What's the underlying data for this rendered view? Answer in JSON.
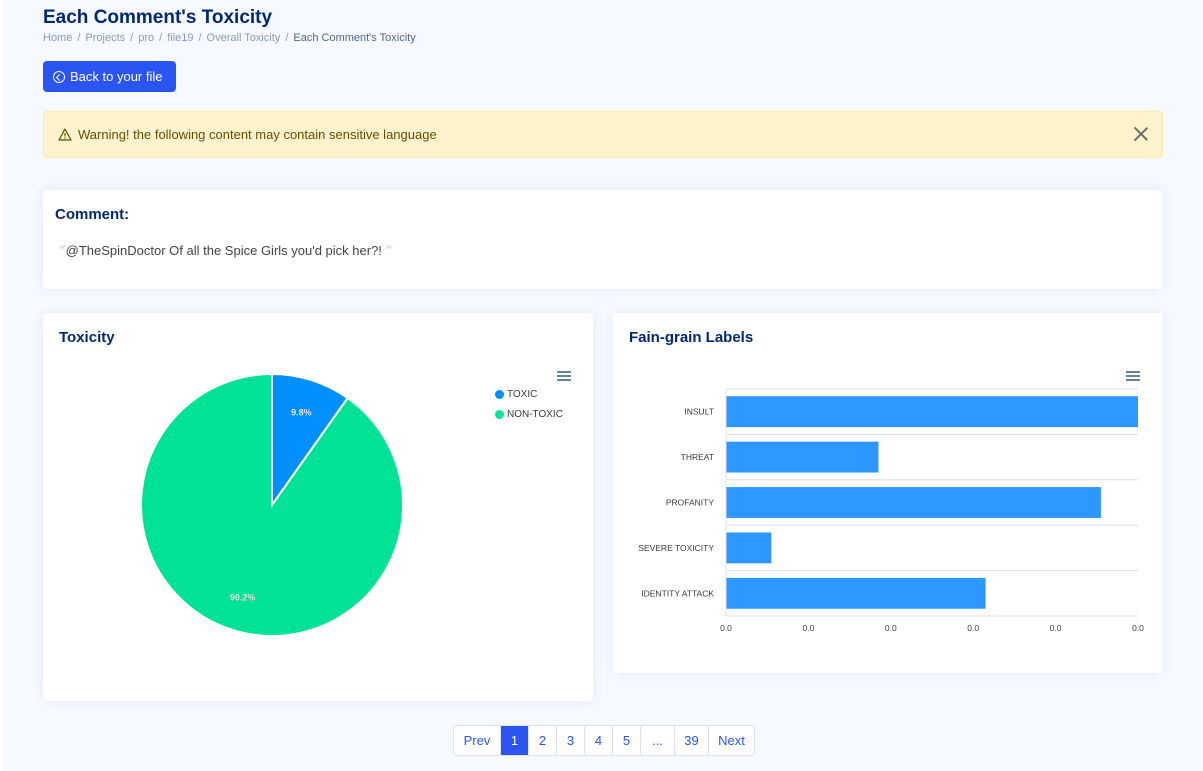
{
  "page": {
    "title": "Each Comment's Toxicity",
    "breadcrumb": [
      "Home",
      "Projects",
      "pro",
      "file19",
      "Overall Toxicity",
      "Each Comment's Toxicity"
    ]
  },
  "back_button": {
    "label": "Back to your file",
    "icon": "arrow-left-circle-icon"
  },
  "alert": {
    "text": "Warning! the following content may contain sensitive language",
    "icon": "exclamation-triangle-icon",
    "color": "#fff3cd"
  },
  "comment_card": {
    "title": "Comment:",
    "open_quote": "“",
    "close_quote": "”",
    "text": "@TheSpinDoctor Of all the Spice Girls you'd pick her?!"
  },
  "toxicity_card": {
    "title": "Toxicity"
  },
  "fine_card": {
    "title": "Fain-grain Labels"
  },
  "chart_data": [
    {
      "type": "pie",
      "title": "Toxicity",
      "labels": [
        "TOXIC",
        "NON-TOXIC"
      ],
      "values": [
        9.8,
        90.2
      ],
      "data_labels": [
        "9.8%",
        "90.2%"
      ],
      "colors": [
        "#008ffb",
        "#00e396"
      ],
      "legend_position": "top-right"
    },
    {
      "type": "bar",
      "orientation": "horizontal",
      "title": "Fain-grain Labels",
      "categories": [
        "INSULT",
        "THREAT",
        "PROFANITY",
        "SEVERE TOXICITY",
        "IDENTITY ATTACK"
      ],
      "values": [
        1.0,
        0.37,
        0.91,
        0.11,
        0.63
      ],
      "x_tick_labels": [
        "0.0",
        "0.0",
        "0.0",
        "0.0",
        "0.0",
        "0.0"
      ],
      "color": "#2e97ff",
      "grid": true
    }
  ],
  "pagination": {
    "prev": "Prev",
    "pages": [
      "1",
      "2",
      "3",
      "4",
      "5",
      "...",
      "39"
    ],
    "active": "1",
    "next": "Next"
  }
}
